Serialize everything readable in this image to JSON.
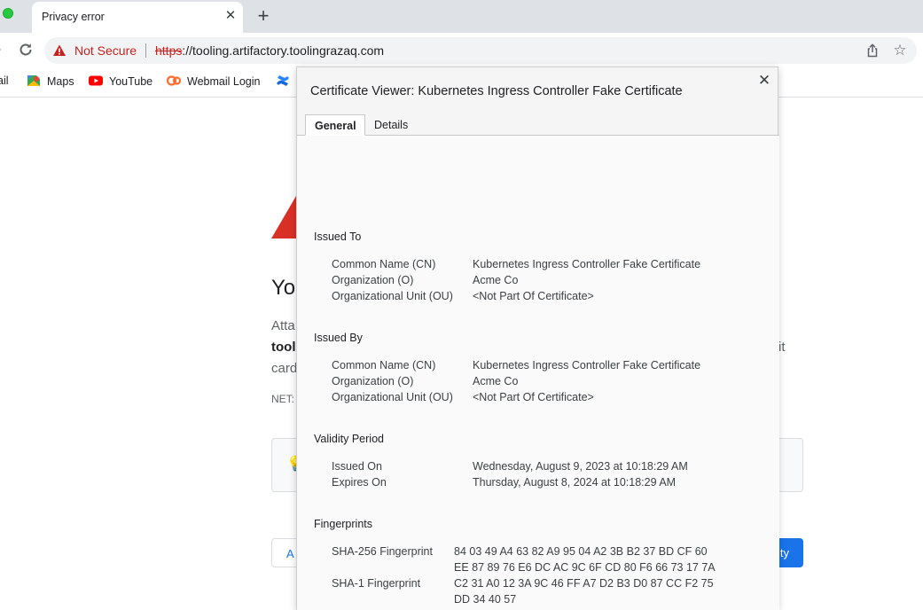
{
  "browser": {
    "tab_title": "Privacy error",
    "tab_close_glyph": "✕",
    "new_tab_glyph": "+",
    "security_label": "Not Secure",
    "url_scheme": "https",
    "url_rest": "://tooling.artifactory.toolingrazaq.com",
    "star_glyph": "☆"
  },
  "bookmarks": [
    {
      "label": "ail",
      "icon": "none"
    },
    {
      "label": "Maps",
      "icon": "maps-icon"
    },
    {
      "label": "YouTube",
      "icon": "youtube-icon"
    },
    {
      "label": "Webmail Login",
      "icon": "cpanel-icon"
    },
    {
      "label": "",
      "icon": "confluence-icon"
    }
  ],
  "page": {
    "heading_fragment": "Yo",
    "text1_fragment": "Atta",
    "text2_fragment": "tool",
    "text2_end_fragment": "it",
    "text3_fragment": "card",
    "net_fragment": "NET:",
    "adv_fragment": "A",
    "back_fragment": "ty",
    "bulb_glyph": "💡"
  },
  "dialog": {
    "title": "Certificate Viewer: Kubernetes Ingress Controller Fake Certificate",
    "close_glyph": "✕",
    "tabs": [
      "General",
      "Details"
    ],
    "issued_to": {
      "heading": "Issued To",
      "rows": [
        {
          "label": "Common Name (CN)",
          "value": "Kubernetes Ingress Controller Fake Certificate"
        },
        {
          "label": "Organization (O)",
          "value": "Acme Co"
        },
        {
          "label": "Organizational Unit (OU)",
          "value": "<Not Part Of Certificate>"
        }
      ]
    },
    "issued_by": {
      "heading": "Issued By",
      "rows": [
        {
          "label": "Common Name (CN)",
          "value": "Kubernetes Ingress Controller Fake Certificate"
        },
        {
          "label": "Organization (O)",
          "value": "Acme Co"
        },
        {
          "label": "Organizational Unit (OU)",
          "value": "<Not Part Of Certificate>"
        }
      ]
    },
    "validity": {
      "heading": "Validity Period",
      "rows": [
        {
          "label": "Issued On",
          "value": "Wednesday, August 9, 2023 at 10:18:29 AM"
        },
        {
          "label": "Expires On",
          "value": "Thursday, August 8, 2024 at 10:18:29 AM"
        }
      ]
    },
    "fingerprints": {
      "heading": "Fingerprints",
      "sha256_label": "SHA-256 Fingerprint",
      "sha256_line1": "84 03 49 A4 63 82 A9 95 04 A2 3B B2 37 BD CF 60",
      "sha256_line2": "EE 87 89 76 E6 DC AC 9C 6F CD 80 F6 66 73 17 7A",
      "sha1_label": "SHA-1 Fingerprint",
      "sha1_line1": "C2 31 A0 12 3A 9C 46 FF A7 D2 B3 D0 87 CC F2 75",
      "sha1_line2": "DD 34 40 57"
    }
  },
  "colors": {
    "danger": "#c5221f",
    "warning_triangle": "#d93025",
    "primary": "#1a73e8"
  }
}
